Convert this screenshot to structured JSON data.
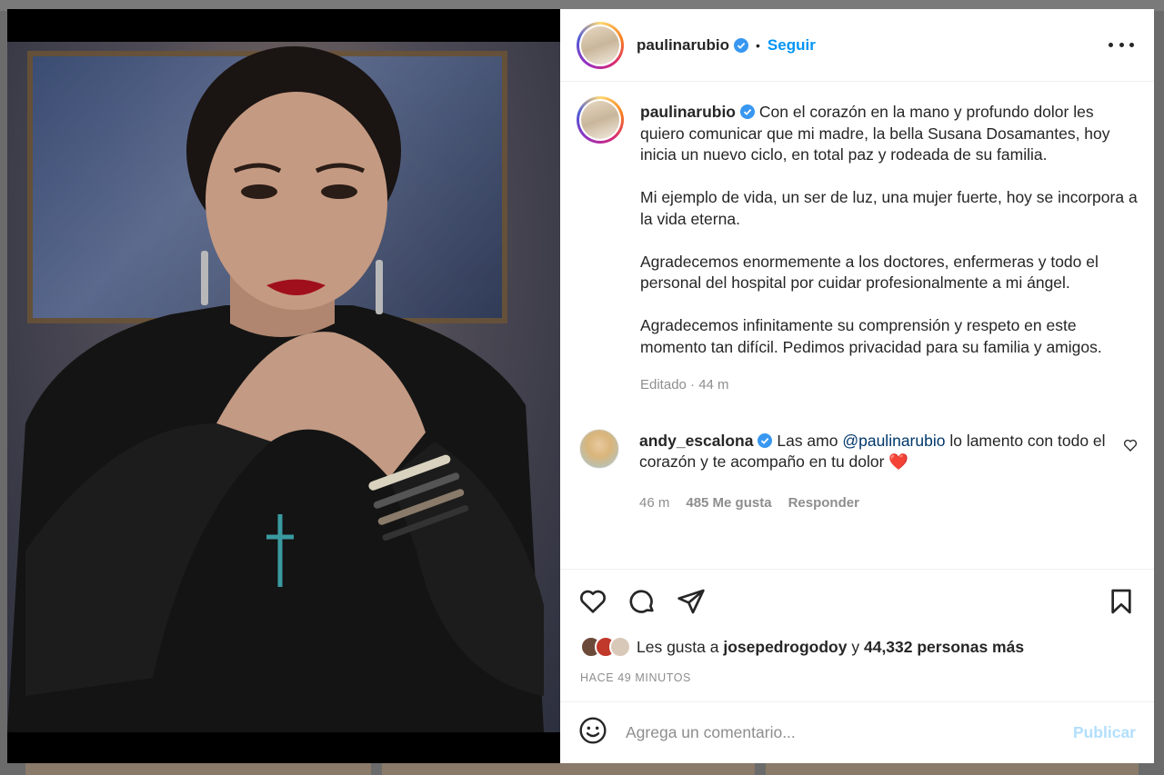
{
  "post": {
    "username": "paulinarubio",
    "follow_label": "Seguir",
    "separator": "•",
    "caption": {
      "username": "paulinarubio",
      "paragraphs": [
        "Con el corazón en la mano y profundo dolor les quiero comunicar que mi madre, la bella Susana Dosamantes, hoy inicia un nuevo ciclo, en total paz y rodeada de su familia.",
        "Mi ejemplo de vida, un ser de luz, una mujer fuerte, hoy se incorpora a la vida eterna.",
        "Agradecemos enormemente a los doctores, enfermeras y todo el personal del hospital por cuidar profesionalmente a mi ángel.",
        "Agradecemos infinitamente su comprensión y respeto en este momento tan difícil. Pedimos privacidad para su familia y amigos."
      ],
      "meta": "Editado · 44 m"
    },
    "comment": {
      "username": "andy_escalona",
      "text_before": "Las amo ",
      "mention": "@paulinarubio",
      "text_after": " lo lamento con todo el corazón y te acompaño en tu dolor ❤️",
      "time": "46 m",
      "likes": "485 Me gusta",
      "reply_label": "Responder"
    },
    "likes": {
      "prefix": "Les gusta a ",
      "user": "josepedrogodoy",
      "middle": " y ",
      "others": "44,332 personas más"
    },
    "timestamp": "HACE 49 MINUTOS",
    "add_comment_placeholder": "Agrega un comentario...",
    "publish_label": "Publicar"
  },
  "colors": {
    "accent": "#0095f6",
    "publish_disabled": "#b2dffc",
    "muted": "#8e8e8e",
    "verified": "#3897f0"
  }
}
